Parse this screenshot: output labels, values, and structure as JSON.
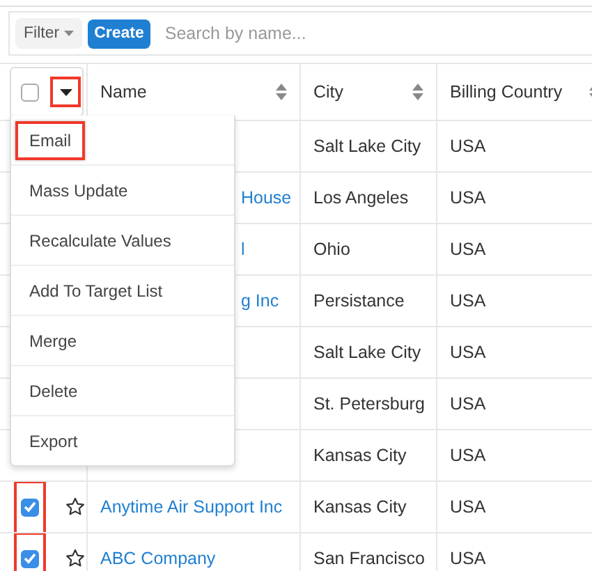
{
  "toolbar": {
    "filter": "Filter",
    "create": "Create",
    "search": {
      "placeholder": "Search by name..."
    }
  },
  "header": {
    "select_all": {
      "checked": false
    },
    "actions_caret": {
      "highlighted": true
    },
    "columns": [
      "Name",
      "City",
      "Billing Country"
    ]
  },
  "rows": [
    {
      "city": "Salt Lake City",
      "country": "USA"
    },
    {
      "name_fragment": "House",
      "city": "Los Angeles",
      "country": "USA"
    },
    {
      "name_fragment": "l",
      "city": "Ohio",
      "country": "USA"
    },
    {
      "name_fragment": "g Inc",
      "city": "Persistance",
      "country": "USA"
    },
    {
      "city": "Salt Lake City",
      "country": "USA"
    },
    {
      "city": "St. Petersburg",
      "country": "USA"
    },
    {
      "city": "Kansas City",
      "country": "USA"
    },
    {
      "name": "Anytime Air Support Inc",
      "city": "Kansas City",
      "country": "USA",
      "checked": true,
      "highlighted": true
    },
    {
      "name": "ABC Company",
      "city": "San Francisco",
      "country": "USA",
      "checked": true,
      "highlighted": true
    }
  ],
  "menu": [
    {
      "label": "Email",
      "highlighted": true
    },
    {
      "label": "Mass Update",
      "highlighted": false
    },
    {
      "label": "Recalculate Values",
      "highlighted": false
    },
    {
      "label": "Add To Target List",
      "highlighted": false
    },
    {
      "label": "Merge",
      "highlighted": false
    },
    {
      "label": "Delete",
      "highlighted": false
    },
    {
      "label": "Export",
      "highlighted": false
    }
  ]
}
